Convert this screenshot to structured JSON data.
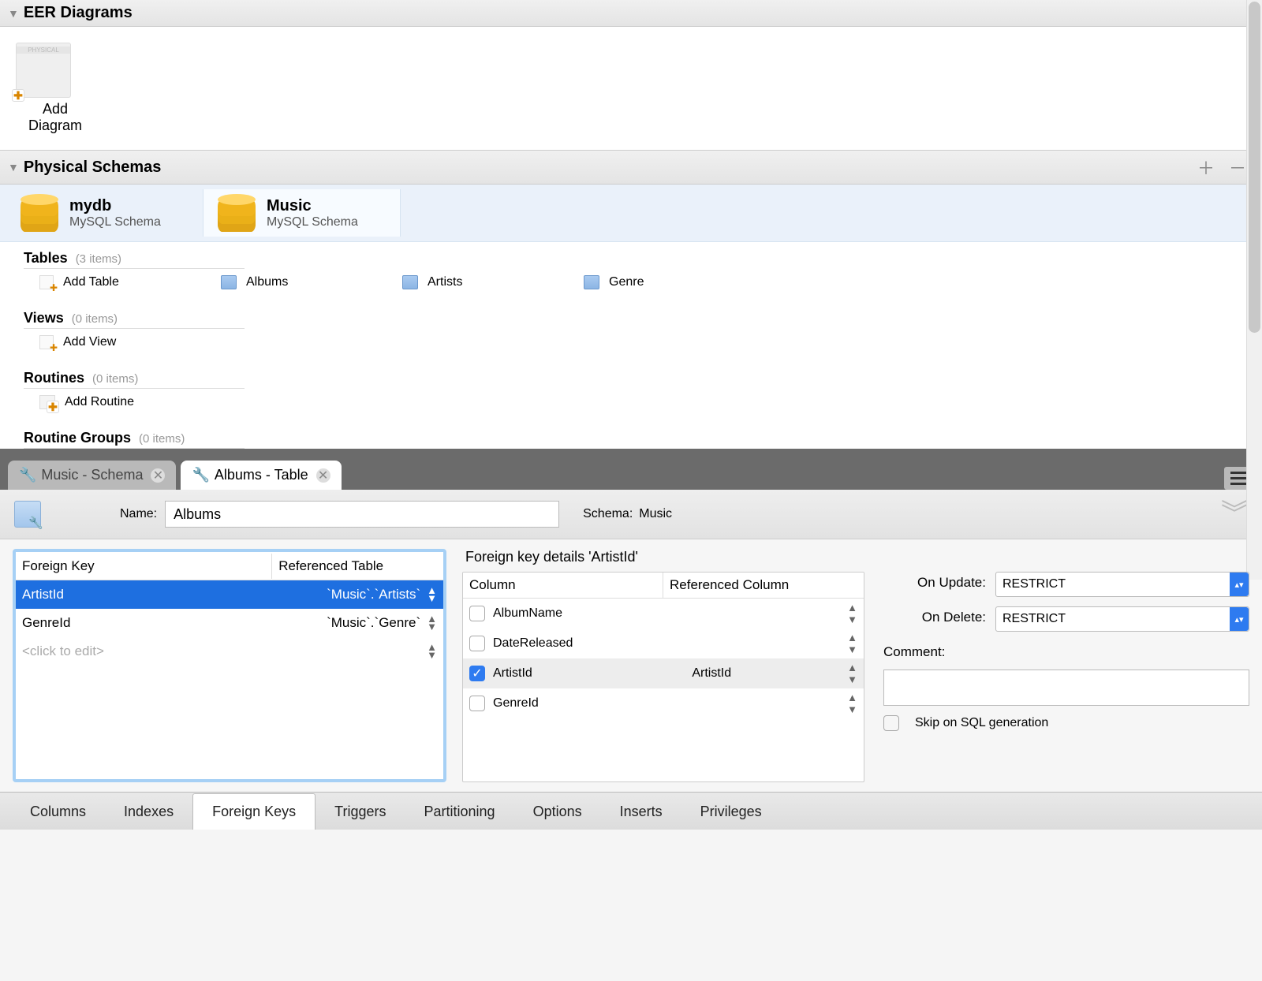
{
  "eer": {
    "title": "EER Diagrams",
    "add": "Add Diagram"
  },
  "schemas": {
    "title": "Physical Schemas",
    "items": [
      {
        "name": "mydb",
        "sub": "MySQL Schema"
      },
      {
        "name": "Music",
        "sub": "MySQL Schema"
      }
    ]
  },
  "tables": {
    "title": "Tables",
    "count": "(3 items)",
    "add": "Add Table",
    "items": [
      "Albums",
      "Artists",
      "Genre"
    ]
  },
  "views": {
    "title": "Views",
    "count": "(0 items)",
    "add": "Add View"
  },
  "routines": {
    "title": "Routines",
    "count": "(0 items)",
    "add": "Add Routine"
  },
  "rgroups": {
    "title": "Routine Groups",
    "count": "(0 items)"
  },
  "tabs": {
    "inactive": "Music - Schema",
    "active": "Albums - Table"
  },
  "form": {
    "nameLabel": "Name:",
    "nameValue": "Albums",
    "schemaLabel": "Schema:",
    "schemaValue": "Music"
  },
  "fk": {
    "head": {
      "c1": "Foreign Key",
      "c2": "Referenced Table"
    },
    "rows": [
      {
        "name": "ArtistId",
        "ref": "`Music`.`Artists`",
        "sel": true
      },
      {
        "name": "GenreId",
        "ref": "`Music`.`Genre`",
        "sel": false
      }
    ],
    "hint": "<click to edit>"
  },
  "details": {
    "title": "Foreign key details 'ArtistId'",
    "colHead": {
      "h1": "Column",
      "h2": "Referenced Column"
    },
    "cols": [
      {
        "name": "AlbumName",
        "ref": "",
        "on": false,
        "sel": false
      },
      {
        "name": "DateReleased",
        "ref": "",
        "on": false,
        "sel": false
      },
      {
        "name": "ArtistId",
        "ref": "ArtistId",
        "on": true,
        "sel": true
      },
      {
        "name": "GenreId",
        "ref": "",
        "on": false,
        "sel": false
      }
    ],
    "onUpdateLabel": "On Update:",
    "onUpdate": "RESTRICT",
    "onDeleteLabel": "On Delete:",
    "onDelete": "RESTRICT",
    "commentLabel": "Comment:",
    "skipLabel": "Skip on SQL generation"
  },
  "bottomTabs": [
    "Columns",
    "Indexes",
    "Foreign Keys",
    "Triggers",
    "Partitioning",
    "Options",
    "Inserts",
    "Privileges"
  ],
  "activeBottomTab": 2
}
